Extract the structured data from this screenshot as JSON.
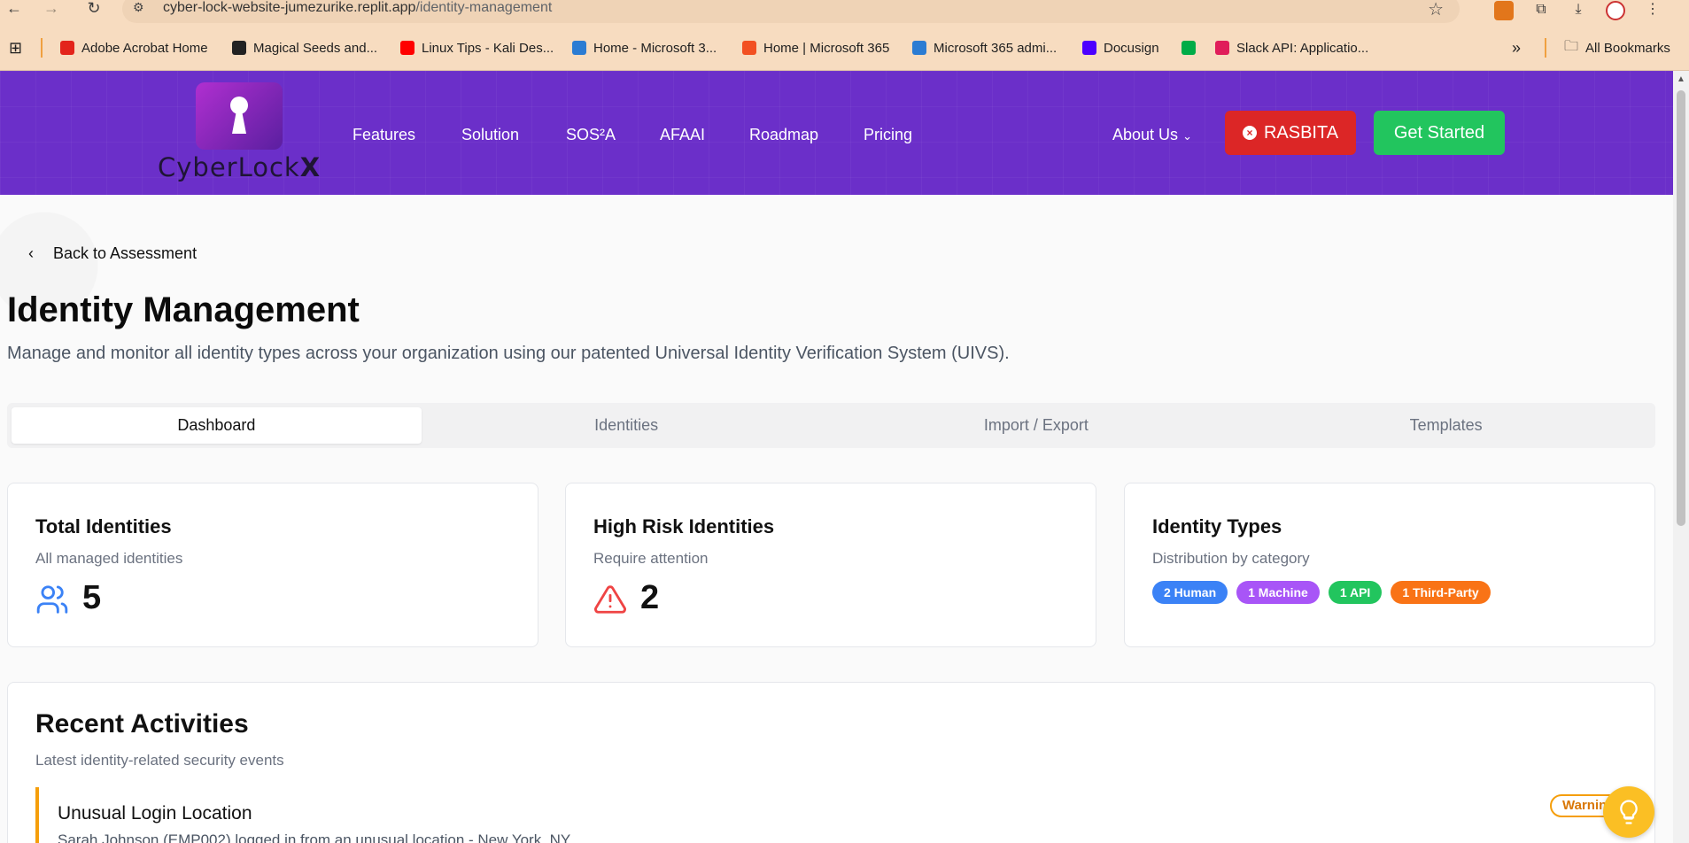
{
  "browser": {
    "url_host": "cyber-lock-website-jumezurike.replit.app",
    "url_path": "/identity-management",
    "bookmarks": [
      {
        "label": "Adobe Acrobat Home",
        "color": "#e3241b"
      },
      {
        "label": "Magical Seeds and...",
        "color": "#222222"
      },
      {
        "label": "Linux Tips - Kali Des...",
        "color": "#ff0000"
      },
      {
        "label": "Home - Microsoft 3...",
        "color": "#2b7cd3"
      },
      {
        "label": "Home | Microsoft 365",
        "color": "#f25022"
      },
      {
        "label": "Microsoft 365 admi...",
        "color": "#2b7cd3"
      },
      {
        "label": "Docusign",
        "color": "#4c00ff"
      },
      {
        "label": "Slack API: Applicatio...",
        "color": "#e01e5a"
      }
    ],
    "all_bookmarks": "All Bookmarks",
    "more_glyph": "»"
  },
  "header": {
    "logo_text_main": "CyberLock",
    "logo_text_accent": "X",
    "nav": [
      "Features",
      "Solution",
      "SOS²A",
      "AFAAI",
      "Roadmap",
      "Pricing"
    ],
    "about": "About Us",
    "rasbita_label": "RASBITA",
    "get_started_label": "Get Started"
  },
  "page": {
    "back_label": "Back to Assessment",
    "title": "Identity Management",
    "subtitle": "Manage and monitor all identity types across your organization using our patented Universal Identity Verification System (UIVS).",
    "tabs": [
      "Dashboard",
      "Identities",
      "Import / Export",
      "Templates"
    ],
    "active_tab": "Dashboard"
  },
  "cards": {
    "total": {
      "title": "Total Identities",
      "desc": "All managed identities",
      "value": "5",
      "icon": "users-icon"
    },
    "risk": {
      "title": "High Risk Identities",
      "desc": "Require attention",
      "value": "2",
      "icon": "alert-triangle-icon"
    },
    "types": {
      "title": "Identity Types",
      "desc": "Distribution by category",
      "pills": [
        {
          "label": "2 Human",
          "color": "#3b82f6"
        },
        {
          "label": "1 Machine",
          "color": "#a855f7"
        },
        {
          "label": "1 API",
          "color": "#22c55e"
        },
        {
          "label": "1 Third-Party",
          "color": "#f97316"
        }
      ]
    }
  },
  "recent": {
    "title": "Recent Activities",
    "desc": "Latest identity-related security events",
    "activity": {
      "title": "Unusual Login Location",
      "desc": "Sarah Johnson (EMP002) logged in from an unusual location - New York, NY",
      "badge": "Warning"
    }
  },
  "colors": {
    "header_bg": "#6b2fc9",
    "rasbita": "#dc2626",
    "get_started": "#22c55e",
    "warning": "#f59e0b"
  }
}
